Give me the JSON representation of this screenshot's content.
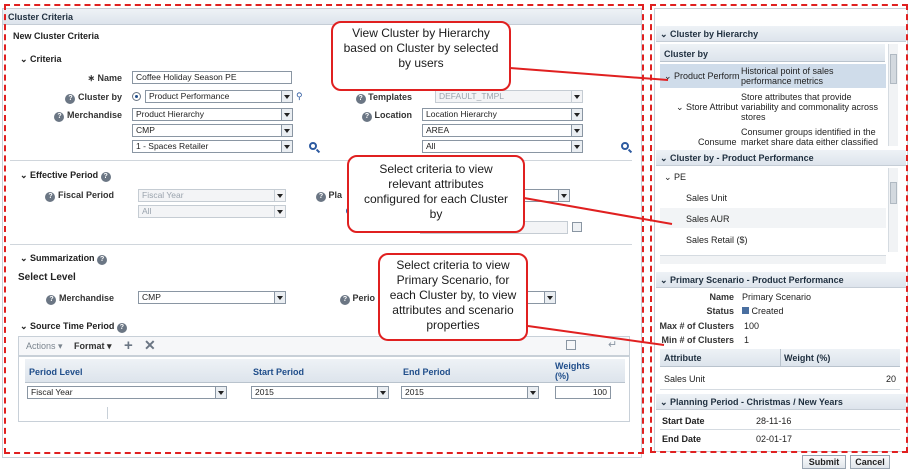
{
  "left_panel": {
    "title": "Cluster Criteria",
    "subtitle": "New Cluster Criteria",
    "criteria": {
      "section": "Criteria",
      "name_label": "Name",
      "name_value": "Coffee Holiday Season PE",
      "cluster_by_label": "Cluster by",
      "cluster_by_value": "Product Performance",
      "merchandise_label": "Merchandise",
      "merch_values": [
        "Product Hierarchy",
        "CMP",
        "1 - Spaces Retailer"
      ],
      "templates_label": "Templates",
      "templates_value": "DEFAULT_TMPL",
      "location_label": "Location",
      "location_values": [
        "Location Hierarchy",
        "AREA",
        "All"
      ]
    },
    "effective": {
      "section": "Effective Period",
      "fiscal_label": "Fiscal Period",
      "fiscal_values": [
        "Fiscal Year",
        "All"
      ],
      "planning_label": "Pla"
    },
    "summarization": {
      "section": "Summarization",
      "select_level": "Select Level",
      "merch_label": "Merchandise",
      "merch_value": "CMP",
      "period_label": "Perio"
    },
    "source_time": {
      "section": "Source Time Period",
      "actions": "Actions",
      "format": "Format",
      "columns": [
        "Period Level",
        "Start Period",
        "End Period",
        "Weights (%)"
      ],
      "rows": [
        [
          "Fiscal Year",
          "2015",
          "2015",
          "100"
        ]
      ]
    }
  },
  "right_panel": {
    "hierarchy": {
      "title": "Cluster by Hierarchy",
      "col": "Cluster by",
      "rows": [
        {
          "name": "Product Perform",
          "desc": "Historical point of sales performance metrics"
        },
        {
          "name": "Store Attribut",
          "desc": "Store attributes that provide variability and commonality across stores"
        },
        {
          "name": "Consume",
          "desc": "Consumer groups identified in the market share data either classified"
        }
      ]
    },
    "cluster_pp": {
      "title": "Cluster by - Product Performance",
      "root": "PE",
      "items": [
        "Sales Unit",
        "Sales AUR",
        "Sales Retail ($)"
      ]
    },
    "primary": {
      "title": "Primary Scenario - Product Performance",
      "name_label": "Name",
      "name_value": "Primary Scenario",
      "status_label": "Status",
      "status_value": "Created",
      "max_label": "Max # of Clusters",
      "max_value": "100",
      "min_label": "Min # of Clusters",
      "min_value": "1",
      "table_cols": [
        "Attribute",
        "Weight (%)"
      ],
      "table_rows": [
        [
          "Sales Unit",
          "20"
        ]
      ]
    },
    "planning": {
      "title": "Planning Period - Christmas / New Years",
      "start_label": "Start Date",
      "start_value": "28-11-16",
      "end_label": "End Date",
      "end_value": "02-01-17"
    }
  },
  "buttons": {
    "submit": "Submit",
    "cancel": "Cancel"
  },
  "callouts": [
    "View Cluster by Hierarchy based on Cluster by  selected by users",
    "Select criteria to view relevant attributes configured  for each Cluster by",
    "Select criteria to view Primary Scenario, for each Cluster by, to view attributes and scenario properties"
  ],
  "colors": {
    "annotation": "#e02020",
    "header": "#dde4ec"
  }
}
